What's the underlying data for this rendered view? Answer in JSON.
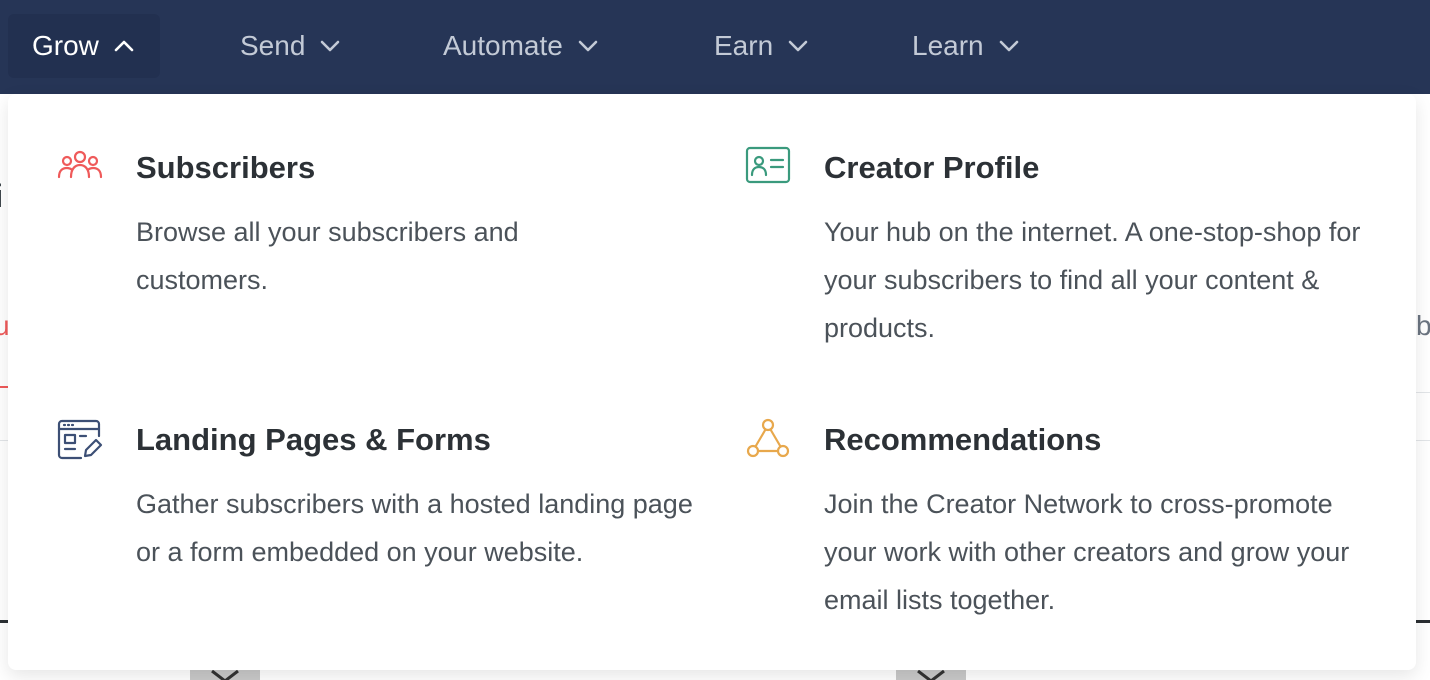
{
  "nav": {
    "items": [
      {
        "label": "Grow",
        "expanded": true
      },
      {
        "label": "Send",
        "expanded": false
      },
      {
        "label": "Automate",
        "expanded": false
      },
      {
        "label": "Earn",
        "expanded": false
      },
      {
        "label": "Learn",
        "expanded": false
      }
    ],
    "colors": {
      "background": "#263556",
      "active_background": "#223050",
      "text": "#c3cad6",
      "active_text": "#ffffff"
    }
  },
  "grow_menu": {
    "items": [
      {
        "title": "Subscribers",
        "description": "Browse all your subscribers and customers.",
        "icon": "people-group-icon",
        "icon_color": "#ef5a5a"
      },
      {
        "title": "Creator Profile",
        "description": "Your hub on the internet. A one-stop-shop for your subscribers to find all your content & products.",
        "icon": "id-card-icon",
        "icon_color": "#3a9a7d"
      },
      {
        "title": "Landing Pages & Forms",
        "description": "Gather subscribers with a hosted landing page or a form embedded on your website.",
        "icon": "browser-form-edit-icon",
        "icon_color": "#3c4f75"
      },
      {
        "title": "Recommendations",
        "description": "Join the Creator Network to cross-promote your work with other creators and grow your email lists together.",
        "icon": "network-nodes-icon",
        "icon_color": "#e8a84c"
      }
    ]
  },
  "background_fragments": {
    "left_top": "i",
    "left_mid": "u",
    "right_mid": "b"
  }
}
